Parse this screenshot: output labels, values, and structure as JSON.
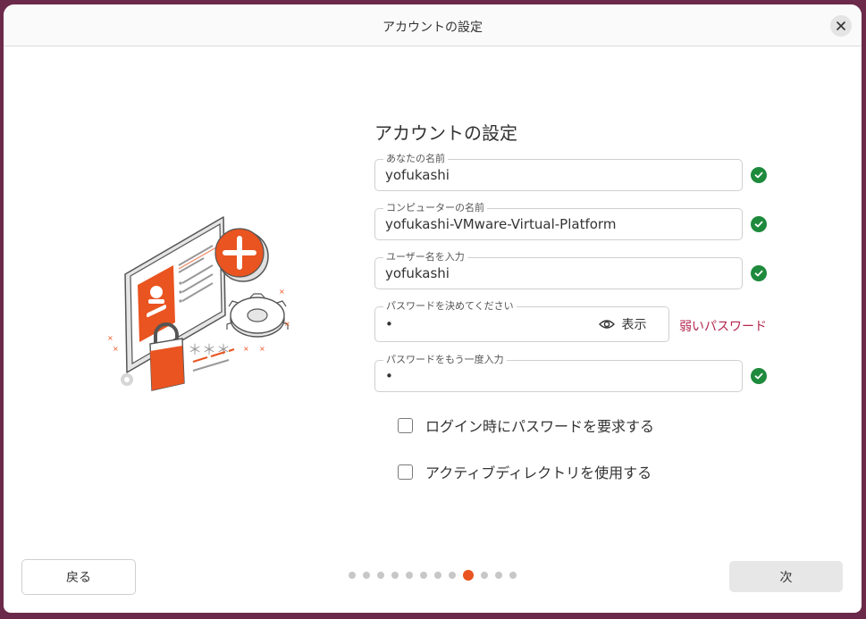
{
  "window": {
    "title": "アカウントの設定"
  },
  "heading": "アカウントの設定",
  "fields": {
    "name": {
      "label": "あなたの名前",
      "value": "yofukashi"
    },
    "computer": {
      "label": "コンピューターの名前",
      "value": "yofukashi-VMware-Virtual-Platform"
    },
    "username": {
      "label": "ユーザー名を入力",
      "value": "yofukashi"
    },
    "password": {
      "label": "パスワードを決めてください",
      "value": "•"
    },
    "confirm": {
      "label": "パスワードをもう一度入力",
      "value": "•"
    }
  },
  "show_button_label": "表示",
  "password_strength": "弱いパスワード",
  "options": {
    "require_password": {
      "label": "ログイン時にパスワードを要求する",
      "checked": false
    },
    "active_directory": {
      "label": "アクティブディレクトリを使用する",
      "checked": false
    }
  },
  "nav": {
    "back": "戻る",
    "next": "次"
  },
  "progress": {
    "total_steps": 12,
    "current_step": 9
  },
  "colors": {
    "accent": "#e95420",
    "success": "#1e8a3c",
    "warning_text": "#b3264e"
  },
  "icons": [
    "close-icon",
    "check-circle-icon",
    "eye-icon"
  ]
}
